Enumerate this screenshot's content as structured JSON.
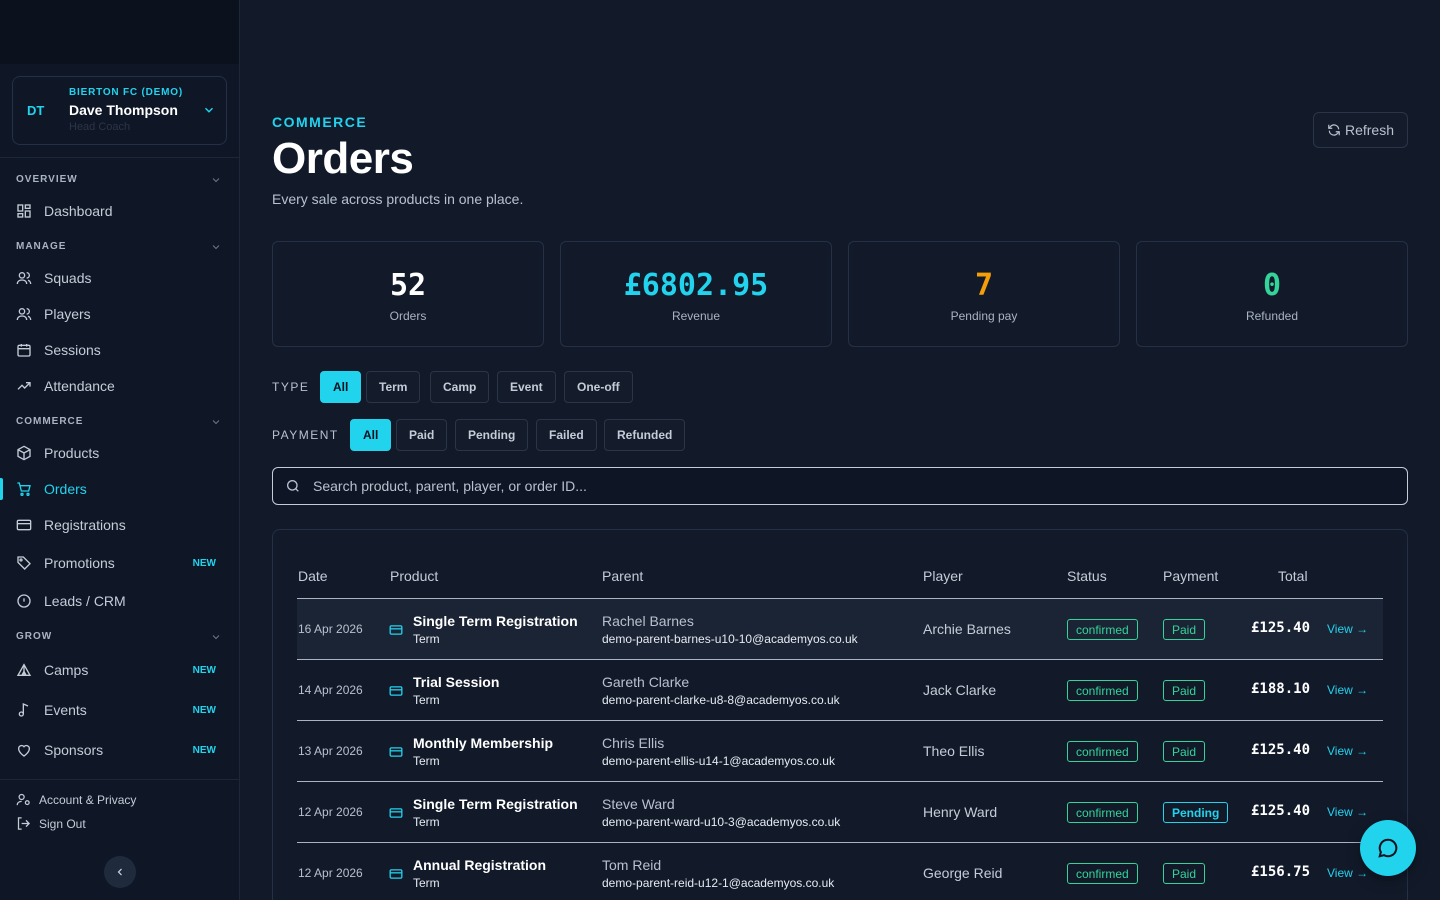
{
  "account": {
    "initials": "DT",
    "club": "BIERTON FC (DEMO)",
    "name": "Dave Thompson",
    "role": "Head Coach"
  },
  "nav": {
    "overview": "OVERVIEW",
    "manage": "MANAGE",
    "commerce": "COMMERCE",
    "grow": "GROW",
    "dashboard": "Dashboard",
    "squads": "Squads",
    "players": "Players",
    "sessions": "Sessions",
    "attendance": "Attendance",
    "products": "Products",
    "orders": "Orders",
    "registrations": "Registrations",
    "promotions": "Promotions",
    "leads": "Leads / CRM",
    "camps": "Camps",
    "events": "Events",
    "sponsors": "Sponsors",
    "new_badge": "NEW",
    "account_privacy": "Account & Privacy",
    "sign_out": "Sign Out"
  },
  "header": {
    "eyebrow": "COMMERCE",
    "title": "Orders",
    "subtitle": "Every sale across products in one place.",
    "refresh": "Refresh"
  },
  "stats": [
    {
      "value": "52",
      "label": "Orders",
      "color": "#ffffff"
    },
    {
      "value": "£6802.95",
      "label": "Revenue",
      "color": "#22d3ee"
    },
    {
      "value": "7",
      "label": "Pending pay",
      "color": "#f59e0b"
    },
    {
      "value": "0",
      "label": "Refunded",
      "color": "#34d399"
    }
  ],
  "filters": {
    "type_label": "TYPE",
    "type": [
      "All",
      "Term",
      "Camp",
      "Event",
      "One-off"
    ],
    "payment_label": "PAYMENT",
    "payment": [
      "All",
      "Paid",
      "Pending",
      "Failed",
      "Refunded"
    ]
  },
  "search": {
    "placeholder": "Search product, parent, player, or order ID..."
  },
  "table": {
    "headers": [
      "Date",
      "Product",
      "Parent",
      "Player",
      "Status",
      "Payment",
      "Total"
    ],
    "view_label": "View →",
    "rows": [
      {
        "date": "16 Apr 2026",
        "product": "Single Term Registration",
        "type": "Term",
        "parent": "Rachel Barnes",
        "email": "demo-parent-barnes-u10-10@academyos.co.uk",
        "player": "Archie Barnes",
        "status": "confirmed",
        "payment": "Paid",
        "total": "£125.40"
      },
      {
        "date": "14 Apr 2026",
        "product": "Trial Session",
        "type": "Term",
        "parent": "Gareth Clarke",
        "email": "demo-parent-clarke-u8-8@academyos.co.uk",
        "player": "Jack Clarke",
        "status": "confirmed",
        "payment": "Paid",
        "total": "£188.10"
      },
      {
        "date": "13 Apr 2026",
        "product": "Monthly Membership",
        "type": "Term",
        "parent": "Chris Ellis",
        "email": "demo-parent-ellis-u14-1@academyos.co.uk",
        "player": "Theo Ellis",
        "status": "confirmed",
        "payment": "Paid",
        "total": "£125.40"
      },
      {
        "date": "12 Apr 2026",
        "product": "Single Term Registration",
        "type": "Term",
        "parent": "Steve Ward",
        "email": "demo-parent-ward-u10-3@academyos.co.uk",
        "player": "Henry Ward",
        "status": "confirmed",
        "payment": "Pending",
        "total": "£125.40"
      },
      {
        "date": "12 Apr 2026",
        "product": "Annual Registration",
        "type": "Term",
        "parent": "Tom Reid",
        "email": "demo-parent-reid-u12-1@academyos.co.uk",
        "player": "George Reid",
        "status": "confirmed",
        "payment": "Paid",
        "total": "£156.75"
      }
    ]
  }
}
